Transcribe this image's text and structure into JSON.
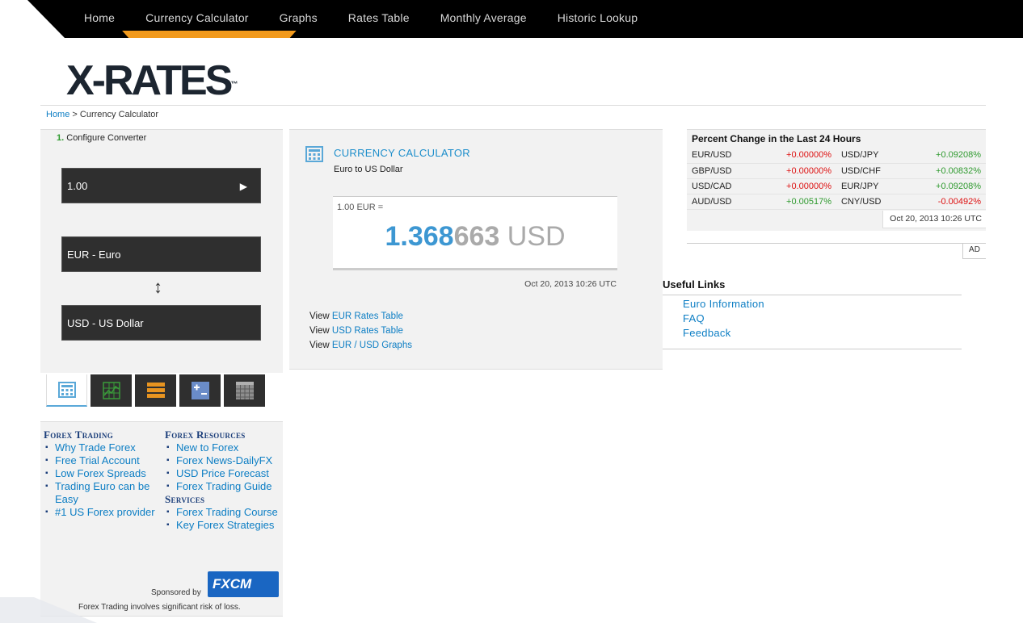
{
  "nav": {
    "items": [
      {
        "label": "Home"
      },
      {
        "label": "Currency Calculator",
        "active": true
      },
      {
        "label": "Graphs"
      },
      {
        "label": "Rates Table"
      },
      {
        "label": "Monthly Average"
      },
      {
        "label": "Historic Lookup"
      }
    ]
  },
  "logo": {
    "text": "X-RATES",
    "tm": "™"
  },
  "breadcrumb": {
    "home": "Home",
    "sep": " > ",
    "current": "Currency Calculator"
  },
  "converter": {
    "step_num": "1.",
    "step_label": " Configure Converter",
    "amount": "1.00",
    "play": "▶",
    "from": "EUR - Euro",
    "swap": "↕",
    "to": "USD - US Dollar"
  },
  "tabs": [
    {
      "name": "calculator-tab-icon",
      "color": "#5aa8d8"
    },
    {
      "name": "graph-tab-icon",
      "color": "#3a9b3a"
    },
    {
      "name": "rates-table-tab-icon",
      "color": "#e89420"
    },
    {
      "name": "monthly-average-tab-icon",
      "color": "#6a8cc8"
    },
    {
      "name": "historic-lookup-tab-icon",
      "color": "#999999"
    }
  ],
  "forex": {
    "col1_heading": "Forex Trading",
    "col1_items": [
      "Why Trade Forex",
      "Free Trial Account",
      "Low Forex Spreads",
      "Trading Euro can be Easy",
      "#1 US Forex provider"
    ],
    "col2_heading": "Forex Resources",
    "col2_items": [
      "New to Forex",
      "Forex News-DailyFX",
      "USD Price Forecast",
      "Forex Trading Guide"
    ],
    "col3_heading": "Services",
    "col3_items": [
      "Forex Trading Course",
      "Key Forex Strategies"
    ],
    "sponsored_by": "Sponsored by",
    "sponsor_logo": "FXCM",
    "risk": "Forex Trading involves significant risk of loss."
  },
  "calculator": {
    "title": "CURRENCY CALCULATOR",
    "subtitle": "Euro to US Dollar",
    "from_amount": "1.00 EUR =",
    "result_major": "1.368",
    "result_minor": "663",
    "result_currency": " USD",
    "timestamp": "Oct 20, 2013 10:26 UTC",
    "view_prefix": "View ",
    "links": [
      "EUR Rates Table",
      "USD Rates Table",
      "EUR / USD Graphs"
    ]
  },
  "percent_change": {
    "title": "Percent Change in the Last 24 Hours",
    "rows": [
      {
        "p1": "EUR/USD",
        "v1": "+0.00000%",
        "c1": "down",
        "p2": "USD/JPY",
        "v2": "+0.09208%",
        "c2": "up"
      },
      {
        "p1": "GBP/USD",
        "v1": "+0.00000%",
        "c1": "down",
        "p2": "USD/CHF",
        "v2": "+0.00832%",
        "c2": "up"
      },
      {
        "p1": "USD/CAD",
        "v1": "+0.00000%",
        "c1": "down",
        "p2": "EUR/JPY",
        "v2": "+0.09208%",
        "c2": "up"
      },
      {
        "p1": "AUD/USD",
        "v1": "+0.00517%",
        "c1": "up",
        "p2": "CNY/USD",
        "v2": "-0.00492%",
        "c2": "down"
      }
    ],
    "timestamp": "Oct 20, 2013 10:26 UTC",
    "ad_label": "AD"
  },
  "useful_links": {
    "title": "Useful Links",
    "items": [
      "Euro Information",
      "FAQ",
      "Feedback"
    ]
  }
}
